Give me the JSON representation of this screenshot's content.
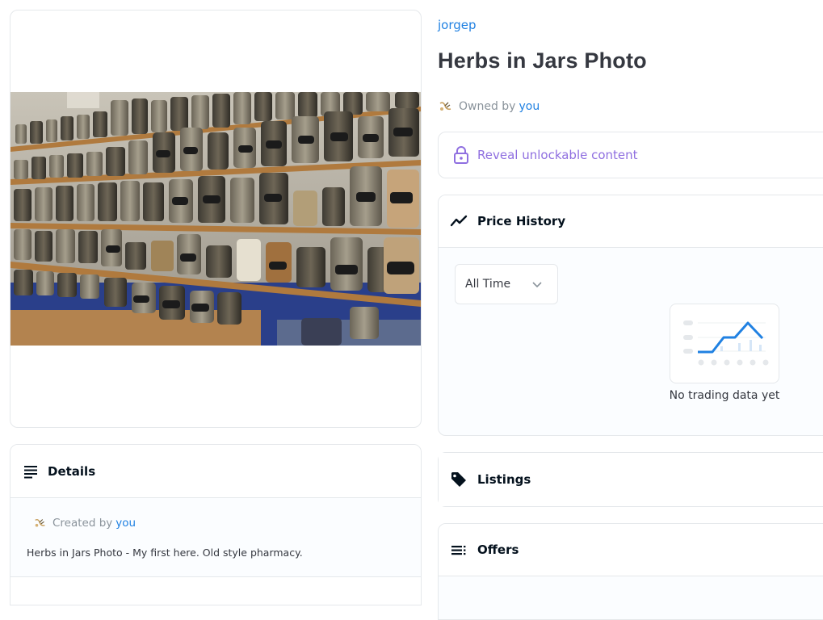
{
  "asset": {
    "collection_name": "jorgep",
    "title": "Herbs in Jars Photo",
    "owned_by_prefix": "Owned by",
    "owned_by_user": "you",
    "image_alt": "Shelves of herb jars"
  },
  "unlockable": {
    "label": "Reveal unlockable content",
    "icon": "lock-icon",
    "accent_color": "#8f6fe0"
  },
  "price_history": {
    "title": "Price History",
    "icon": "trending-icon",
    "filter_selected": "All Time",
    "empty_text": "No trading data yet"
  },
  "listings": {
    "title": "Listings",
    "icon": "tag-icon"
  },
  "offers": {
    "title": "Offers",
    "icon": "list-icon"
  },
  "details": {
    "title": "Details",
    "icon": "notes-icon",
    "created_by_prefix": "Created by",
    "created_by_user": "you",
    "description": "Herbs in Jars Photo - My first here. Old style pharmacy."
  },
  "colors": {
    "link": "#2081e2",
    "text": "#353840",
    "muted": "#8a939b",
    "border": "#e5e8eb",
    "chart_line": "#2081e2"
  }
}
